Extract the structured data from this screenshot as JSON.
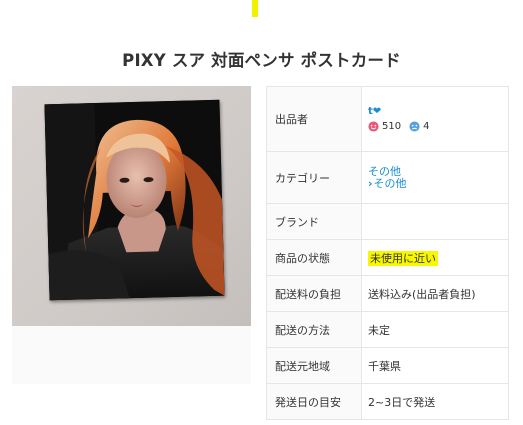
{
  "listing": {
    "title": "PIXY スア 対面ペンサ ポストカード"
  },
  "colors": {
    "accent": "#f2f200",
    "link": "#1a8fd0",
    "highlight": "#f7f700",
    "good_face": "#e9597a",
    "bad_face": "#5aa0d8"
  },
  "details": {
    "seller": {
      "label": "出品者",
      "name": "t❤",
      "good_count": "510",
      "bad_count": "4"
    },
    "category": {
      "label": "カテゴリー",
      "primary": "その他",
      "secondary": "その他"
    },
    "brand": {
      "label": "ブランド",
      "value": ""
    },
    "condition": {
      "label": "商品の状態",
      "value": "未使用に近い"
    },
    "shipping_fee": {
      "label": "配送料の負担",
      "value": "送料込み(出品者負担)"
    },
    "shipping_method": {
      "label": "配送の方法",
      "value": "未定"
    },
    "ship_from": {
      "label": "配送元地域",
      "value": "千葉県"
    },
    "ship_days": {
      "label": "発送日の目安",
      "value": "2~3日で発送"
    }
  }
}
